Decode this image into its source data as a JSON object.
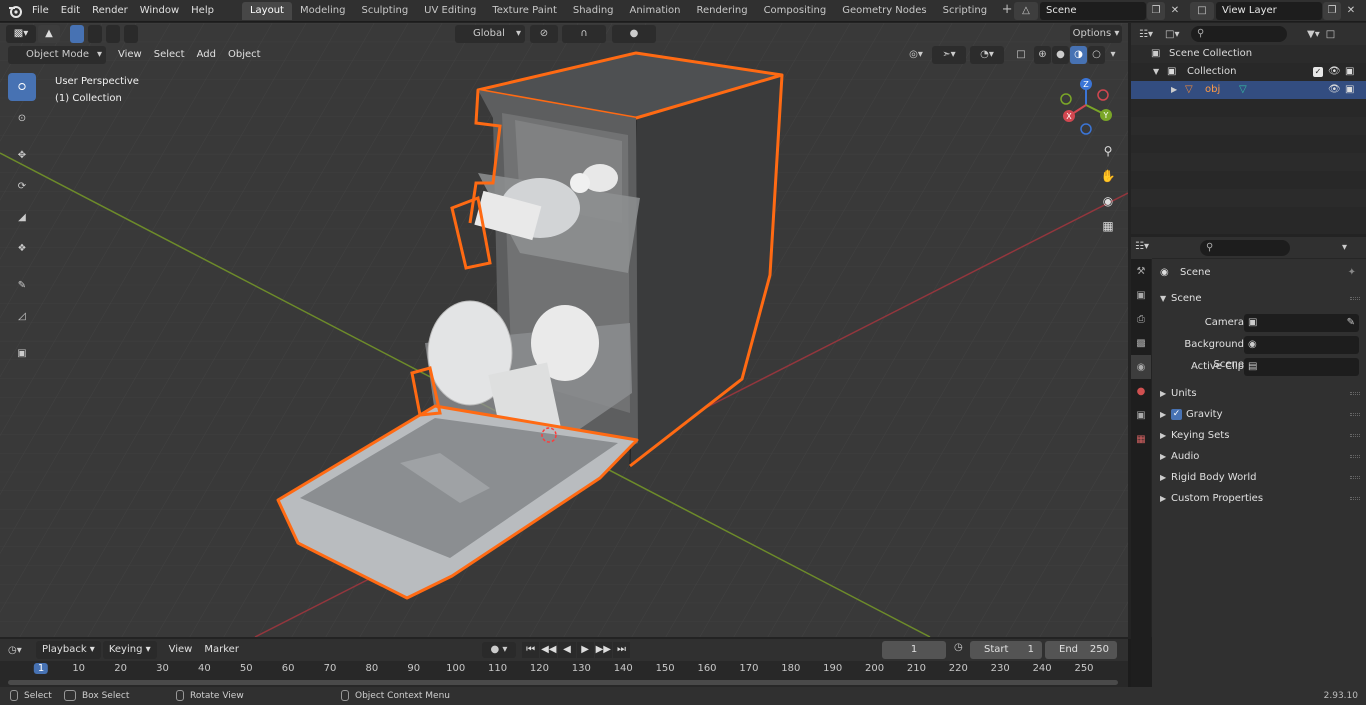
{
  "topbar": {
    "menus": [
      "File",
      "Edit",
      "Render",
      "Window",
      "Help"
    ],
    "workspaces": [
      "Layout",
      "Modeling",
      "Sculpting",
      "UV Editing",
      "Texture Paint",
      "Shading",
      "Animation",
      "Rendering",
      "Compositing",
      "Geometry Nodes",
      "Scripting"
    ],
    "active_workspace": "Layout",
    "scene_name": "Scene",
    "view_layer": "View Layer"
  },
  "viewport": {
    "mode": "Object Mode",
    "menus": [
      "View",
      "Select",
      "Add",
      "Object"
    ],
    "orientation": "Global",
    "options_label": "Options",
    "perspective_label": "User Perspective",
    "collection_label": "(1) Collection",
    "gizmo_axes": [
      "X",
      "Y",
      "Z"
    ]
  },
  "outliner": {
    "scene_collection": "Scene Collection",
    "collection": "Collection",
    "object": "obj"
  },
  "properties": {
    "context_title": "Scene",
    "panel_scene": "Scene",
    "camera_label": "Camera",
    "background_scene_label": "Background Scene",
    "active_clip_label": "Active Clip",
    "panels": [
      "Units",
      "Gravity",
      "Keying Sets",
      "Audio",
      "Rigid Body World",
      "Custom Properties"
    ]
  },
  "timeline": {
    "menus": [
      "Playback",
      "Keying",
      "View",
      "Marker"
    ],
    "current_frame": "1",
    "start_label": "Start",
    "start_value": "1",
    "end_label": "End",
    "end_value": "250",
    "ruler": [
      "1",
      "10",
      "20",
      "30",
      "40",
      "50",
      "60",
      "70",
      "80",
      "90",
      "100",
      "110",
      "120",
      "130",
      "140",
      "150",
      "160",
      "170",
      "180",
      "190",
      "200",
      "210",
      "220",
      "230",
      "240",
      "250"
    ]
  },
  "statusbar": {
    "select": "Select",
    "box_select": "Box Select",
    "rotate_view": "Rotate View",
    "context_menu": "Object Context Menu",
    "version": "2.93.10"
  },
  "colors": {
    "accent": "#4772b3",
    "selection_outline": "#ff6a13",
    "viewport_bg": "#393939"
  }
}
